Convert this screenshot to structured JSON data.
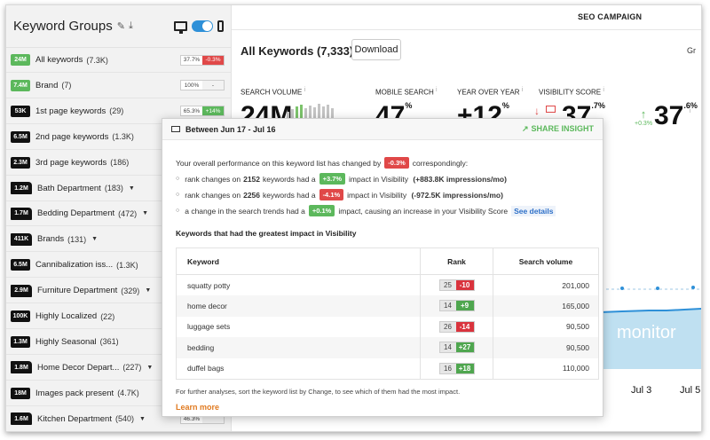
{
  "sidebar": {
    "title": "Keyword Groups",
    "groups": [
      {
        "badge": "24M",
        "badge_style": "green",
        "name": "All keywords",
        "count": "(7.3K)",
        "pct": "37.7%",
        "chg": "-0.3%",
        "chg_color": "red",
        "caret": false
      },
      {
        "badge": "7.4M",
        "badge_style": "green",
        "name": "Brand",
        "count": "(7)",
        "pct": "100%",
        "chg": "-",
        "chg_color": "gray",
        "caret": false
      },
      {
        "badge": "53K",
        "badge_style": "dark",
        "name": "1st page keywords",
        "count": "(29)",
        "pct": "65.3%",
        "chg": "+14%",
        "chg_color": "green",
        "caret": false
      },
      {
        "badge": "6.5M",
        "badge_style": "dark",
        "name": "2nd page keywords",
        "count": "(1.3K)",
        "pct": "",
        "chg": "",
        "chg_color": "",
        "caret": false
      },
      {
        "badge": "2.3M",
        "badge_style": "dark",
        "name": "3rd page keywords",
        "count": "(186)",
        "pct": "",
        "chg": "",
        "chg_color": "",
        "caret": false
      },
      {
        "badge": "1.2M",
        "badge_style": "folder",
        "name": "Bath Department",
        "count": "(183)",
        "pct": "",
        "chg": "",
        "chg_color": "",
        "caret": true
      },
      {
        "badge": "1.7M",
        "badge_style": "folder",
        "name": "Bedding Department",
        "count": "(472)",
        "pct": "",
        "chg": "",
        "chg_color": "",
        "caret": true
      },
      {
        "badge": "411K",
        "badge_style": "folder",
        "name": "Brands",
        "count": "(131)",
        "pct": "",
        "chg": "",
        "chg_color": "",
        "caret": true
      },
      {
        "badge": "6.5M",
        "badge_style": "dark",
        "name": "Cannibalization iss...",
        "count": "(1.3K)",
        "pct": "",
        "chg": "",
        "chg_color": "",
        "caret": false
      },
      {
        "badge": "2.9M",
        "badge_style": "folder",
        "name": "Furniture Department",
        "count": "(329)",
        "pct": "",
        "chg": "",
        "chg_color": "",
        "caret": true
      },
      {
        "badge": "100K",
        "badge_style": "dark",
        "name": "Highly Localized",
        "count": "(22)",
        "pct": "",
        "chg": "",
        "chg_color": "",
        "caret": false
      },
      {
        "badge": "1.3M",
        "badge_style": "dark",
        "name": "Highly Seasonal",
        "count": "(361)",
        "pct": "",
        "chg": "",
        "chg_color": "",
        "caret": false
      },
      {
        "badge": "1.8M",
        "badge_style": "folder",
        "name": "Home Decor Depart...",
        "count": "(227)",
        "pct": "",
        "chg": "",
        "chg_color": "",
        "caret": true
      },
      {
        "badge": "18M",
        "badge_style": "dark",
        "name": "Images pack present",
        "count": "(4.7K)",
        "pct": "",
        "chg": "",
        "chg_color": "",
        "caret": false
      },
      {
        "badge": "1.6M",
        "badge_style": "folder",
        "name": "Kitchen Department",
        "count": "(540)",
        "pct": "46.3%",
        "chg": "",
        "chg_color": "",
        "caret": true
      }
    ]
  },
  "main": {
    "campaign": "SEO CAMPAIGN",
    "title": "All Keywords (7,333)",
    "download": "Download",
    "gr": "Gr",
    "metrics": [
      {
        "label": "SEARCH VOLUME",
        "value": "24M"
      },
      {
        "label": "MOBILE SEARCH",
        "value": "47",
        "suffix": "%"
      },
      {
        "label": "YEAR OVER YEAR",
        "value": "+12",
        "suffix": "%"
      },
      {
        "label": "VISIBILITY SCORE",
        "value": "37",
        "suffix": ".7%"
      }
    ],
    "side_metric": {
      "value": "37",
      "suffix": ".6%",
      "change": "+0.3%"
    },
    "watermark": "monitor",
    "x_ticks": [
      "Jul 3",
      "Jul 5"
    ]
  },
  "popup": {
    "date_range": "Between Jun 17 - Jul 16",
    "share": "SHARE INSIGHT",
    "summary_pre": "Your overall performance on this keyword list has changed by",
    "summary_pill": "-0.3%",
    "summary_post": "correspondingly:",
    "lines": [
      {
        "pre": "rank changes on",
        "bold": "2152",
        "mid": "keywords had a",
        "pill": "+3.7%",
        "pill_color": "green",
        "post": "impact in Visibility",
        "detail": "(+883.8K impressions/mo)"
      },
      {
        "pre": "rank changes on",
        "bold": "2256",
        "mid": "keywords had a",
        "pill": "-4.1%",
        "pill_color": "red",
        "post": "impact in Visibility",
        "detail": "(-972.5K impressions/mo)"
      },
      {
        "pre": "a change in the search trends had a",
        "bold": "",
        "mid": "",
        "pill": "+0.1%",
        "pill_color": "green",
        "post": "impact, causing an increase in your Visibility Score",
        "detail": "",
        "link": "See details"
      }
    ],
    "table_title": "Keywords that had the greatest impact in Visibility",
    "columns": [
      "Keyword",
      "Rank",
      "Search volume"
    ],
    "rows": [
      {
        "keyword": "squatty potty",
        "rank": "25",
        "delta": "-10",
        "delta_color": "red",
        "volume": "201,000"
      },
      {
        "keyword": "home decor",
        "rank": "14",
        "delta": "+9",
        "delta_color": "green",
        "volume": "165,000"
      },
      {
        "keyword": "luggage sets",
        "rank": "26",
        "delta": "-14",
        "delta_color": "red",
        "volume": "90,500"
      },
      {
        "keyword": "bedding",
        "rank": "14",
        "delta": "+27",
        "delta_color": "green",
        "volume": "90,500"
      },
      {
        "keyword": "duffel bags",
        "rank": "16",
        "delta": "+18",
        "delta_color": "green",
        "volume": "110,000"
      }
    ],
    "footer": "For further analyses, sort the keyword list by Change, to see which of them had the most impact.",
    "learn_more": "Learn more"
  },
  "colors": {
    "accent_blue": "#2e90d8",
    "green": "#5cb85c",
    "red": "#e04848",
    "orange": "#e07a20"
  }
}
